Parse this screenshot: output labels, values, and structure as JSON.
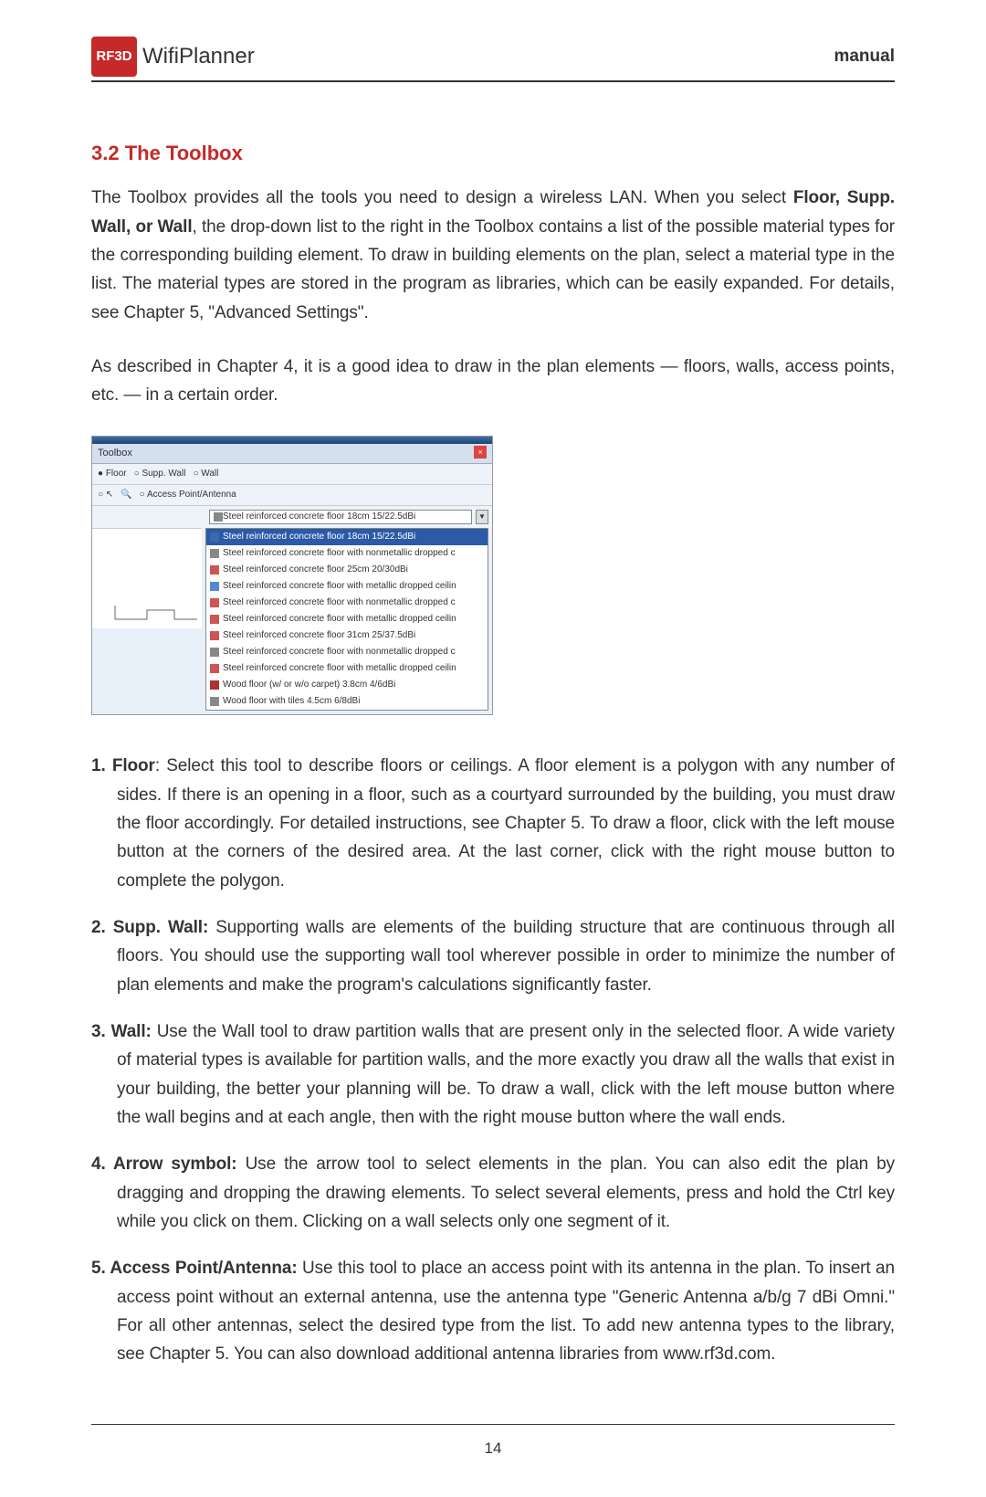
{
  "header": {
    "logo_prefix": "RF3D",
    "logo_text": "WifiPlanner",
    "right_label": "manual"
  },
  "section": {
    "title": "3.2 The Toolbox",
    "para1_a": "The Toolbox provides all the tools you need to design a wireless LAN. When you select ",
    "para1_bold": "Floor, Supp. Wall, or Wall",
    "para1_b": ", the drop-down list to the right in the Toolbox contains a list of the possible material types for the corresponding building element. To draw in building elements on the plan, select a material type in the list. The material types are stored in the program as libraries, which can be easily expanded. For details, see Chapter 5, \"Advanced Settings\".",
    "para2": "As described in Chapter 4, it is a good idea to draw in the plan elements — floors, walls, access points, etc. — in a certain order."
  },
  "toolbox": {
    "title": "Toolbox",
    "radios": [
      "Floor",
      "Supp. Wall",
      "Wall",
      "Access Point/Antenna"
    ],
    "selected_value": "Steel reinforced concrete floor  18cm 15/22.5dBi",
    "list_items": [
      {
        "text": "Steel reinforced concrete floor  18cm 15/22.5dBi",
        "color": "#3a6aa8",
        "highlighted": true
      },
      {
        "text": "Steel reinforced concrete floor with nonmetallic dropped c",
        "color": "#888",
        "highlighted": false
      },
      {
        "text": "Steel reinforced concrete floor  25cm 20/30dBi",
        "color": "#c55",
        "highlighted": false
      },
      {
        "text": "Steel reinforced concrete floor with metallic dropped ceilin",
        "color": "#58c",
        "highlighted": false
      },
      {
        "text": "Steel reinforced concrete floor with nonmetallic dropped c",
        "color": "#c55",
        "highlighted": false
      },
      {
        "text": "Steel reinforced concrete floor with metallic dropped ceilin",
        "color": "#c55",
        "highlighted": false
      },
      {
        "text": "Steel reinforced concrete floor  31cm 25/37.5dBi",
        "color": "#c55",
        "highlighted": false
      },
      {
        "text": "Steel reinforced concrete floor with nonmetallic dropped c",
        "color": "#888",
        "highlighted": false
      },
      {
        "text": "Steel reinforced concrete floor with metallic dropped ceilin",
        "color": "#c55",
        "highlighted": false
      },
      {
        "text": "Wood floor (w/ or w/o carpet) 3.8cm 4/6dBi",
        "color": "#a33",
        "highlighted": false
      },
      {
        "text": "Wood floor with tiles 4.5cm 6/8dBi",
        "color": "#888",
        "highlighted": false
      }
    ]
  },
  "list": [
    {
      "num": "1.",
      "title": "Floor",
      "sep": ": ",
      "text": "Select this tool to describe floors or ceilings. A floor element is a polygon with any number of sides. If there is an opening in a floor, such as a courtyard surrounded by the building, you must draw the floor accordingly. For detailed instructions, see Chapter 5. To draw a floor, click with the left mouse button at the corners of the desired area. At the last corner, click with the right mouse button to complete the polygon."
    },
    {
      "num": "2.",
      "title": "Supp. Wall:",
      "sep": " ",
      "text": "Supporting walls are elements of the building structure that are continuous through all floors. You should use the supporting wall tool wherever possible in order to minimize the number of plan elements and make the program's calculations significantly faster."
    },
    {
      "num": "3.",
      "title": "Wall:",
      "sep": " ",
      "text": "Use the Wall tool to draw partition walls that are present only in the selected floor. A wide variety of material types is available for partition walls, and the more exactly you draw all the walls that exist in your building, the better your planning will be. To draw a wall, click with the left mouse button where the wall begins and at each angle, then with the right mouse button where the wall ends."
    },
    {
      "num": "4.",
      "title": "Arrow symbol:",
      "sep": " ",
      "text": "Use the arrow tool to select elements in the plan. You can also edit the plan by dragging and dropping the drawing elements. To select several elements, press and hold the Ctrl key while you click on them. Clicking on a wall selects only one segment of it."
    },
    {
      "num": "5.",
      "title": "Access Point/Antenna:",
      "sep": " ",
      "text": "Use this tool to place an access point with its antenna in the plan. To insert an access point without an external antenna, use the antenna type \"Generic Antenna a/b/g 7 dBi Omni.\" For all other antennas, select the desired type from the list. To add new antenna types to the library, see Chapter 5. You can also download additional antenna libraries from www.rf3d.com."
    }
  ],
  "footer": {
    "page_number": "14"
  }
}
